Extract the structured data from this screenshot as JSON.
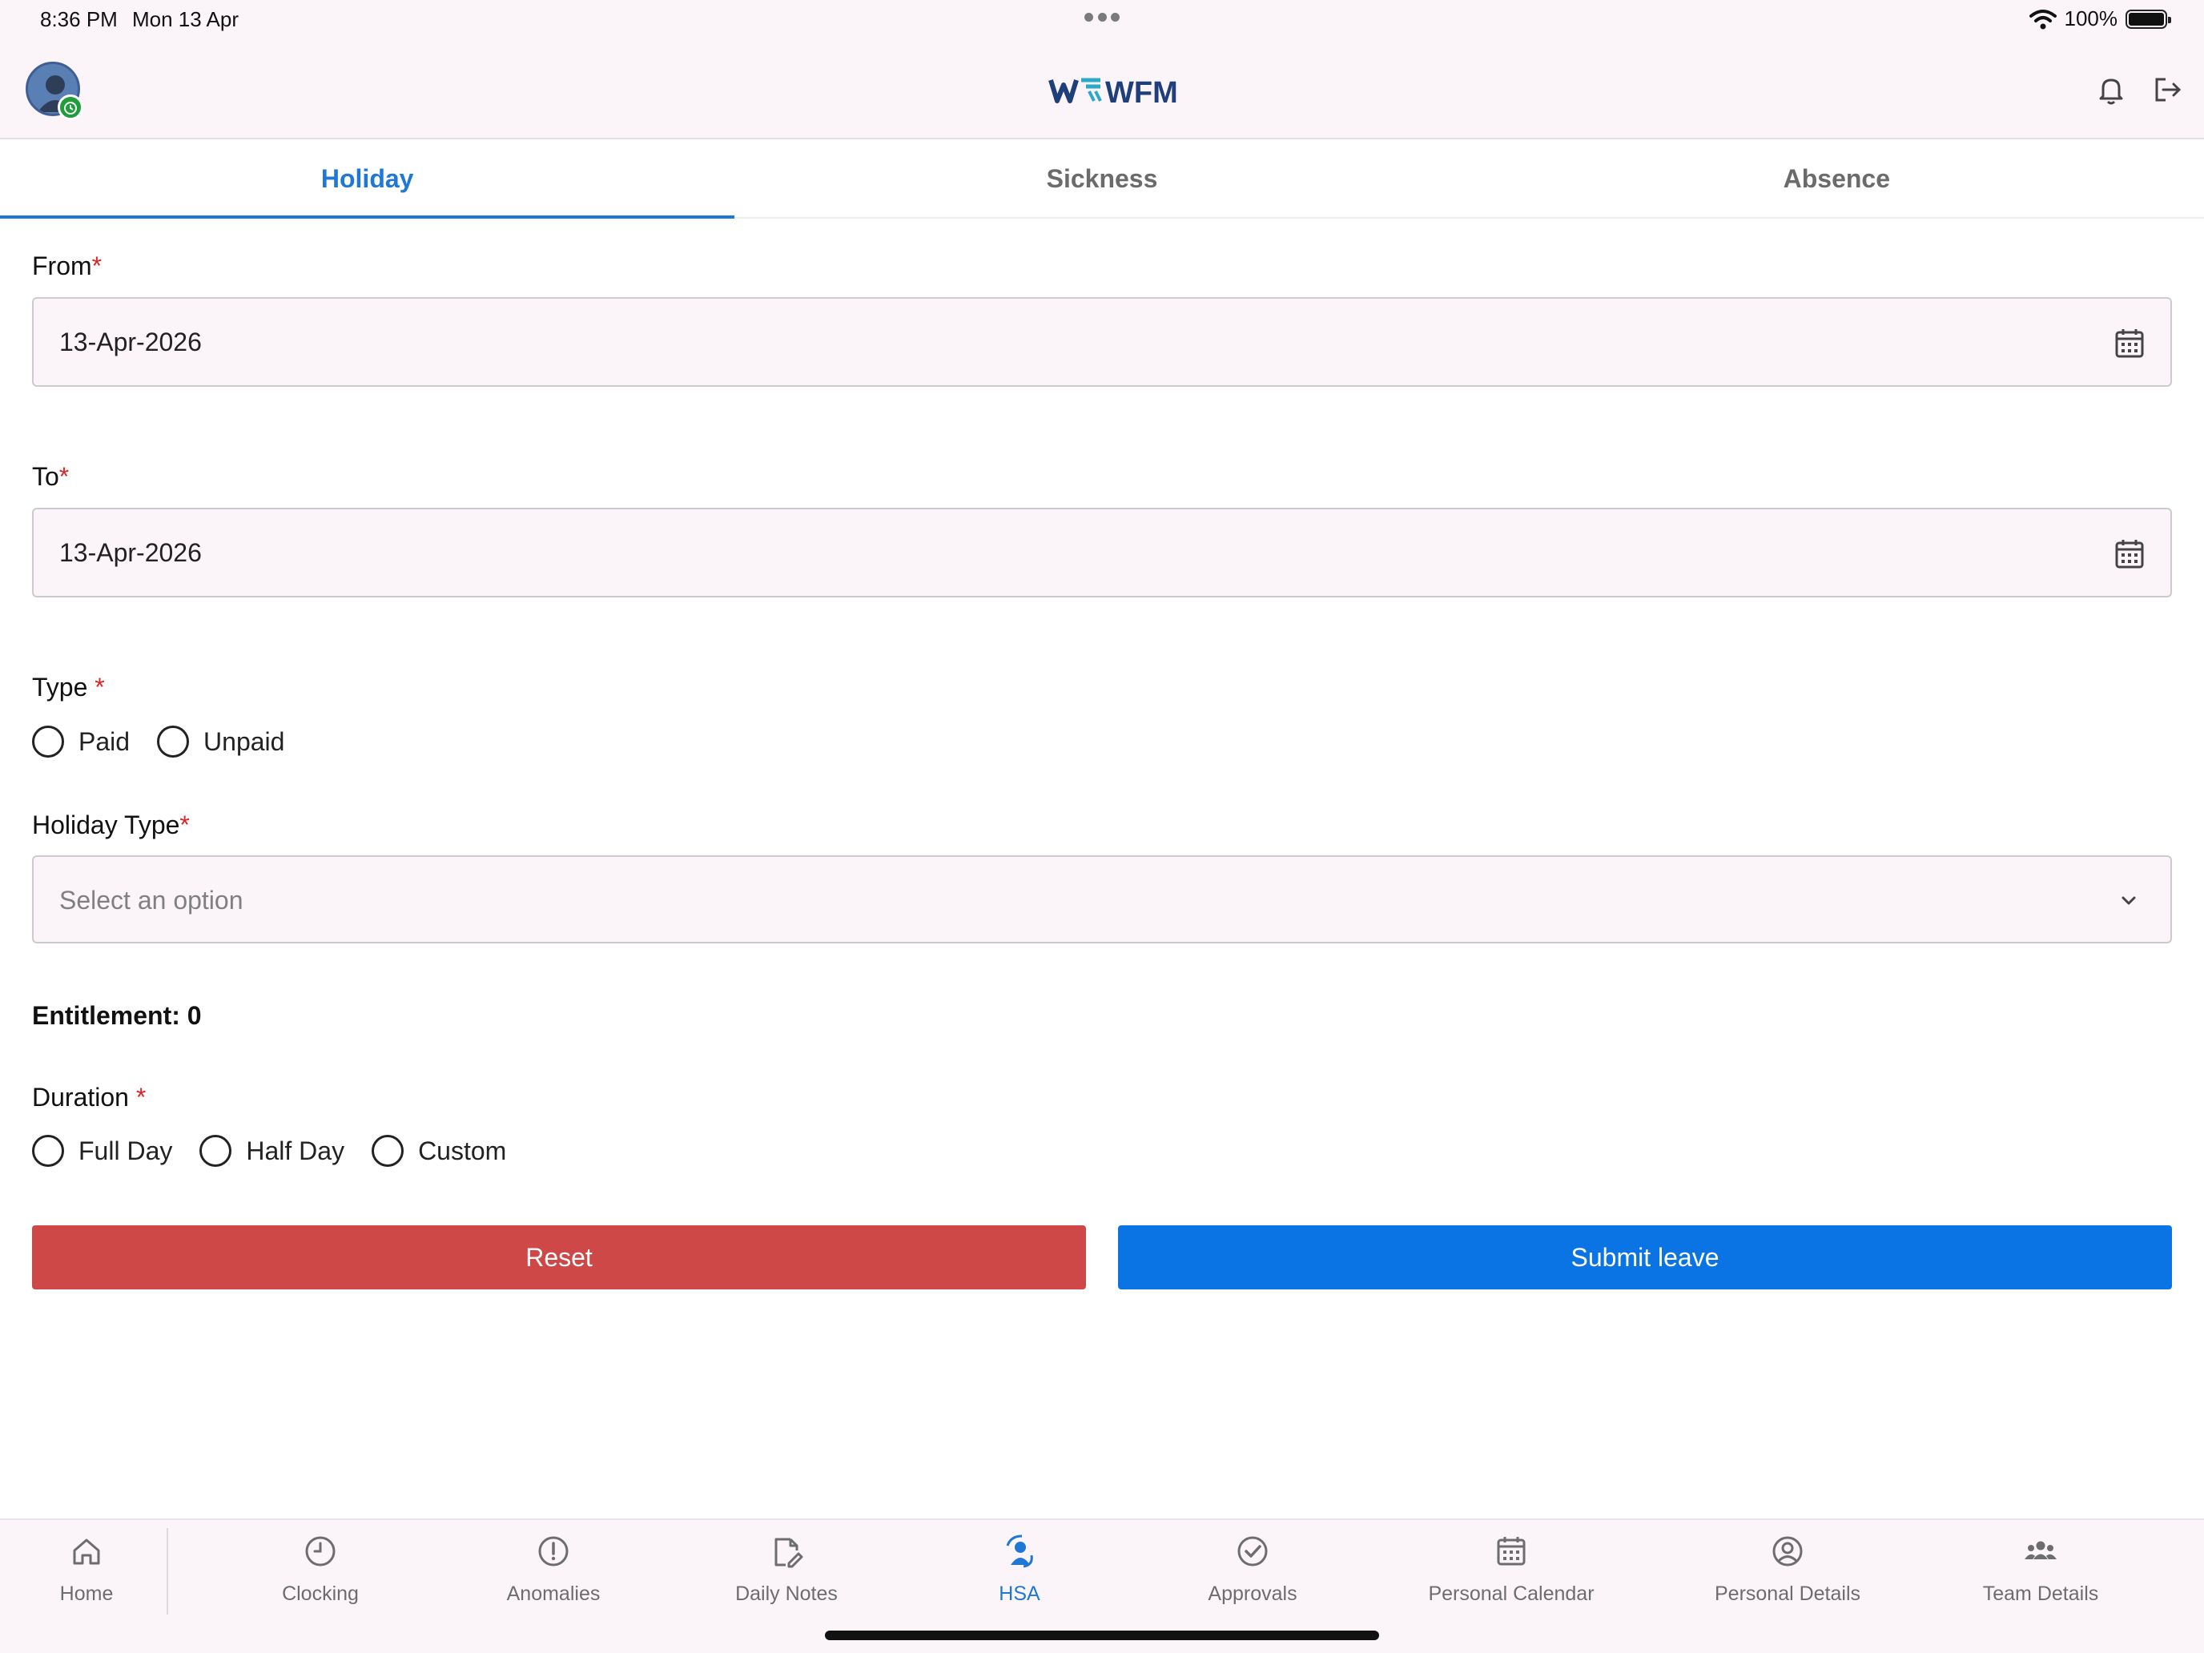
{
  "status": {
    "time": "8:36 PM",
    "date": "Mon 13 Apr",
    "battery": "100%"
  },
  "header": {
    "logo_text": "WFM"
  },
  "tabs": [
    {
      "label": "Holiday",
      "active": true
    },
    {
      "label": "Sickness",
      "active": false
    },
    {
      "label": "Absence",
      "active": false
    }
  ],
  "form": {
    "from_label": "From",
    "from_value": "13-Apr-2026",
    "to_label": "To",
    "to_value": "13-Apr-2026",
    "type_label": "Type",
    "type_options": [
      "Paid",
      "Unpaid"
    ],
    "holiday_type_label": "Holiday Type",
    "holiday_type_placeholder": "Select an option",
    "entitlement": "Entitlement: 0",
    "duration_label": "Duration",
    "duration_options": [
      "Full Day",
      "Half Day",
      "Custom"
    ],
    "required_mark": "*"
  },
  "buttons": {
    "reset": "Reset",
    "submit": "Submit leave"
  },
  "nav": [
    {
      "label": "Home",
      "icon": "home-icon"
    },
    {
      "label": "Clocking",
      "icon": "clock-icon"
    },
    {
      "label": "Anomalies",
      "icon": "alert-circle-icon"
    },
    {
      "label": "Daily Notes",
      "icon": "note-edit-icon"
    },
    {
      "label": "HSA",
      "icon": "person-sync-icon",
      "active": true
    },
    {
      "label": "Approvals",
      "icon": "check-circle-icon"
    },
    {
      "label": "Personal Calendar",
      "icon": "calendar-icon"
    },
    {
      "label": "Personal Details",
      "icon": "user-circle-icon"
    },
    {
      "label": "Team Details",
      "icon": "team-icon"
    }
  ],
  "colors": {
    "accent": "#1f78d6",
    "reset": "#cf4848",
    "submit": "#0b74e5",
    "required": "#d92727"
  }
}
